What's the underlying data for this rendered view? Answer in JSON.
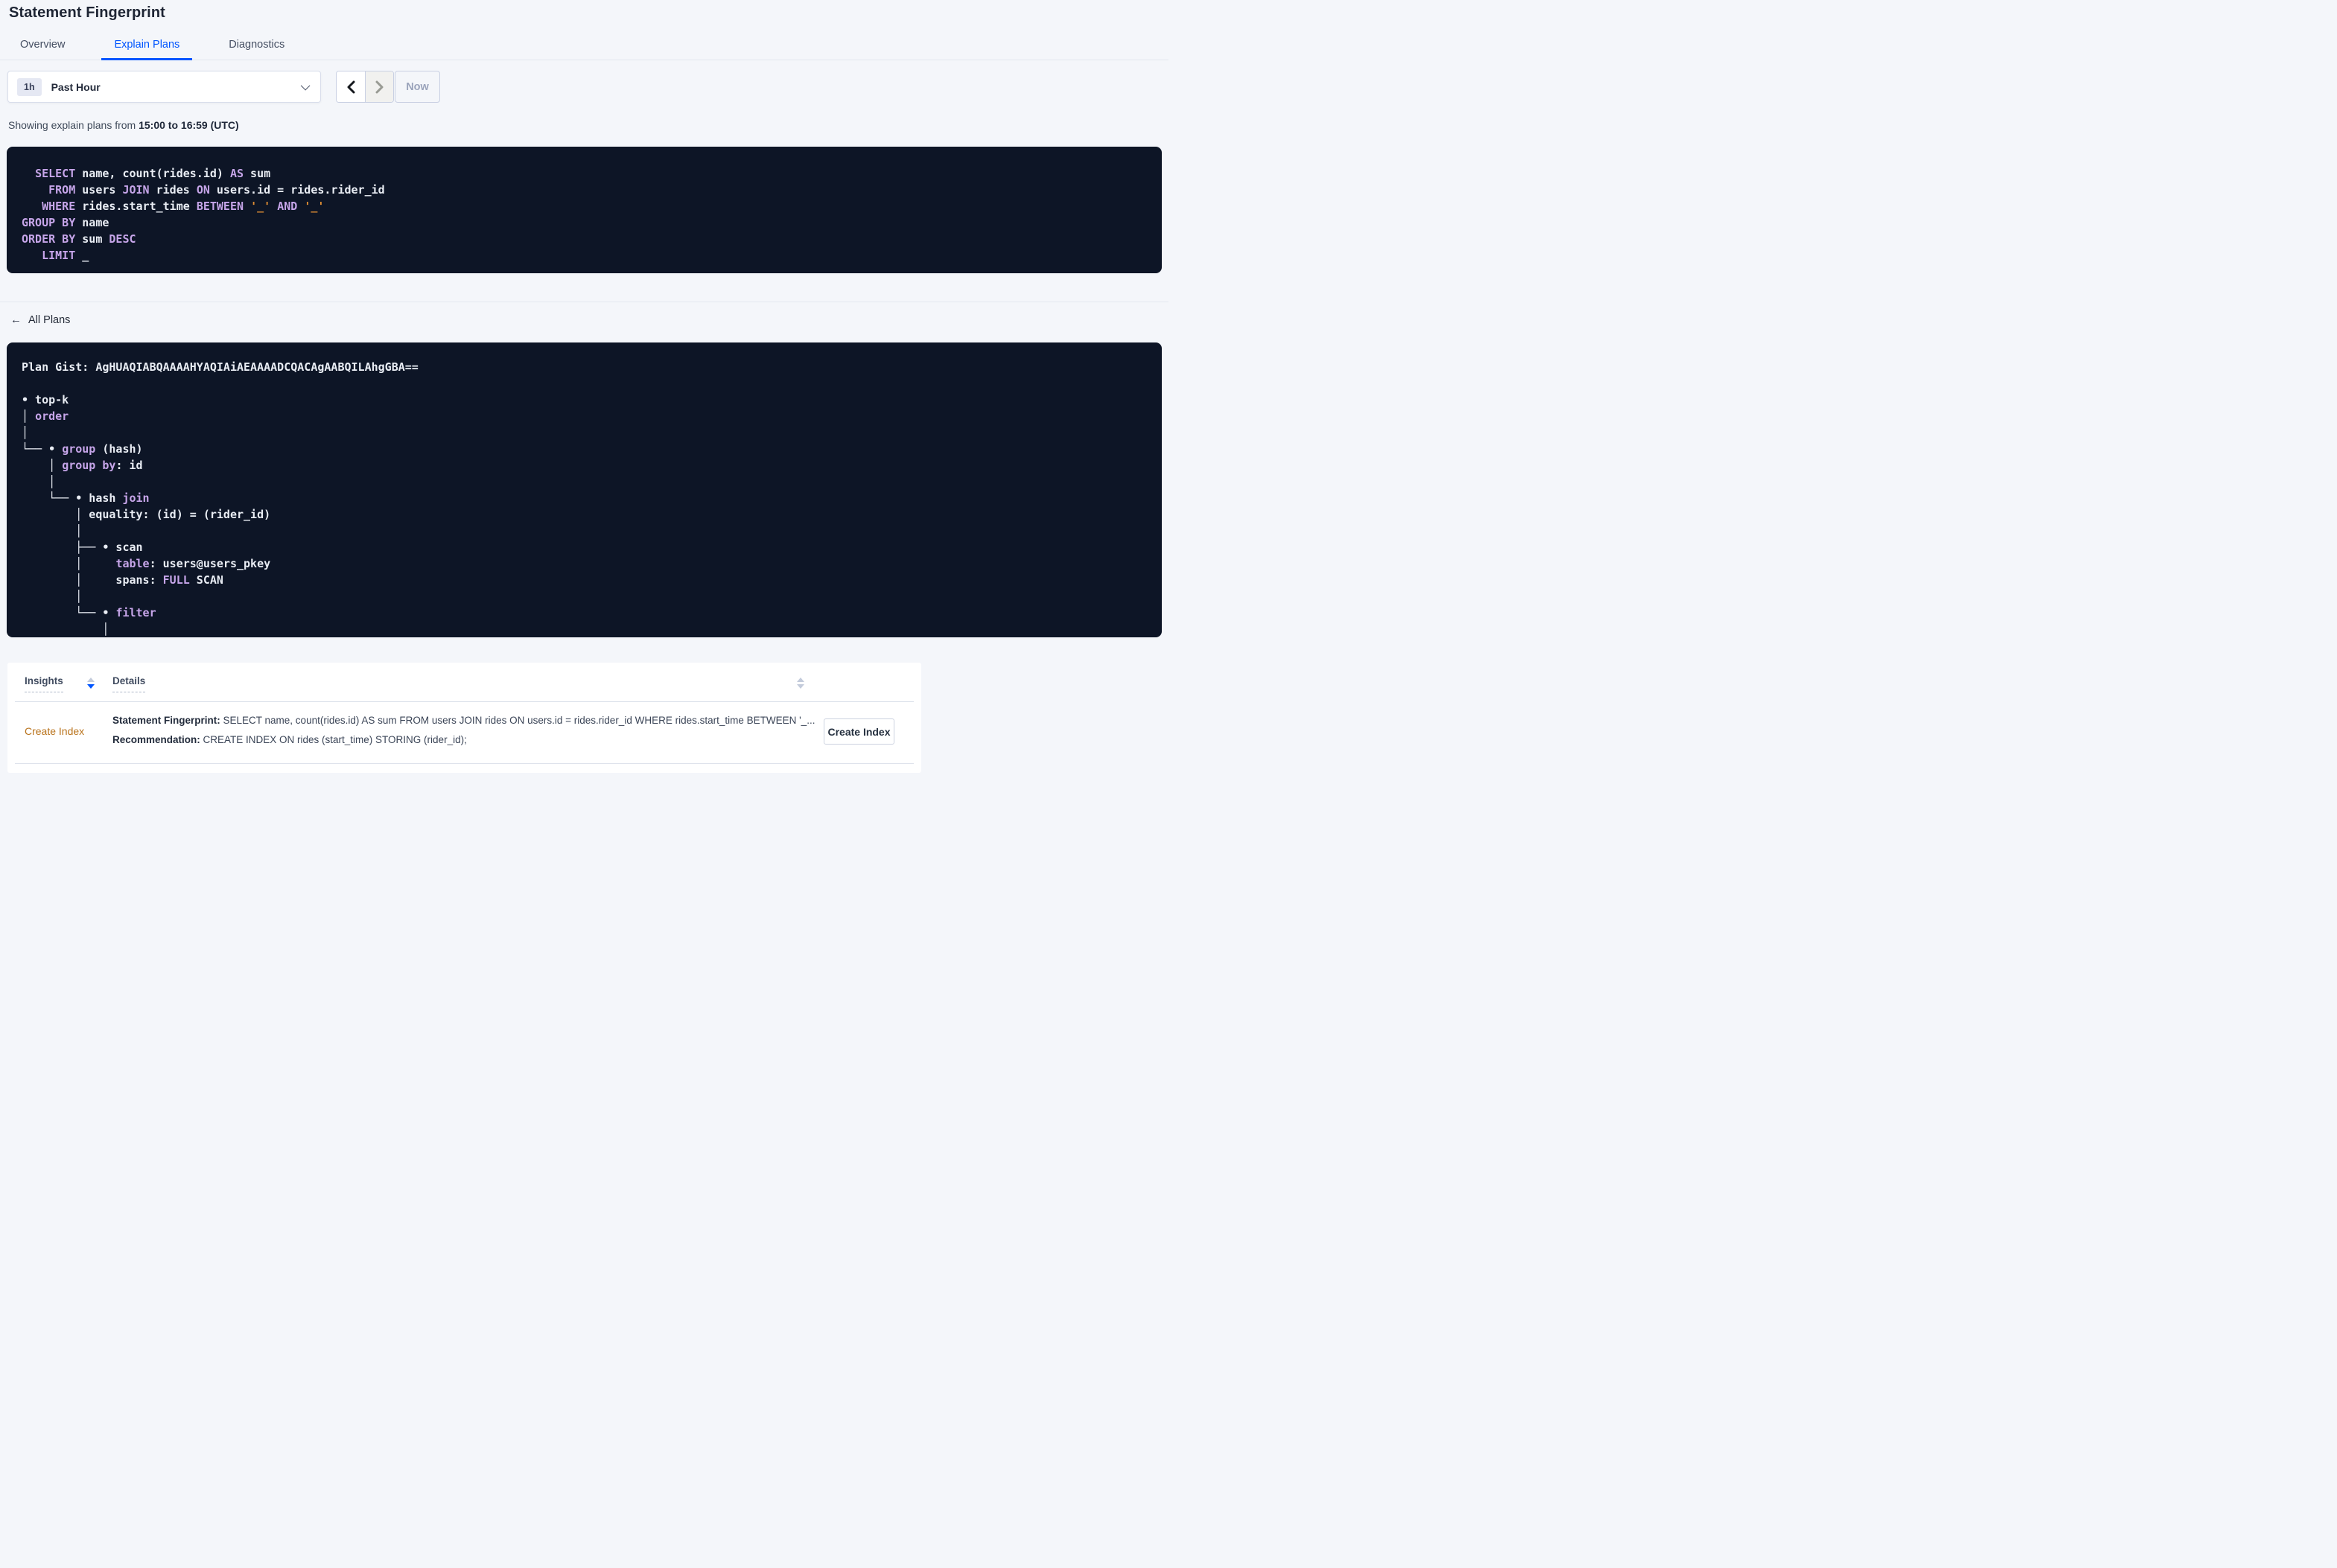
{
  "colors": {
    "accent_blue": "#0055ff",
    "code_background": "#0d1526",
    "code_keyword": "#c6a5e9",
    "code_literal": "#dd8c33",
    "code_text": "#e9edf4",
    "insight_orange": "#b9731c",
    "page_background": "#f4f6fa"
  },
  "icons": {
    "back_arrow": "←"
  },
  "page": {
    "title": "Statement Fingerprint"
  },
  "tabs": [
    {
      "label": "Overview",
      "active": false
    },
    {
      "label": "Explain Plans",
      "active": true
    },
    {
      "label": "Diagnostics",
      "active": false
    }
  ],
  "time_picker": {
    "interval_badge": "1h",
    "selected_range": "Past Hour",
    "now_label": "Now"
  },
  "summary": {
    "prefix": "Showing explain plans from ",
    "range": "15:00 to 16:59 (UTC)"
  },
  "sql_statement": {
    "lines": [
      [
        {
          "t": "  ",
          "c": "plain"
        },
        {
          "t": "SELECT",
          "c": "kw"
        },
        {
          "t": " name, count(rides.id) ",
          "c": "plain"
        },
        {
          "t": "AS",
          "c": "kw"
        },
        {
          "t": " sum",
          "c": "plain"
        }
      ],
      [
        {
          "t": "    ",
          "c": "plain"
        },
        {
          "t": "FROM",
          "c": "kw"
        },
        {
          "t": " users ",
          "c": "plain"
        },
        {
          "t": "JOIN",
          "c": "kw"
        },
        {
          "t": " rides ",
          "c": "plain"
        },
        {
          "t": "ON",
          "c": "kw"
        },
        {
          "t": " users.id = rides.rider_id",
          "c": "plain"
        }
      ],
      [
        {
          "t": "   ",
          "c": "plain"
        },
        {
          "t": "WHERE",
          "c": "kw"
        },
        {
          "t": " rides.start_time ",
          "c": "plain"
        },
        {
          "t": "BETWEEN",
          "c": "kw"
        },
        {
          "t": " ",
          "c": "plain"
        },
        {
          "t": "'_'",
          "c": "str"
        },
        {
          "t": " ",
          "c": "plain"
        },
        {
          "t": "AND",
          "c": "kw"
        },
        {
          "t": " ",
          "c": "plain"
        },
        {
          "t": "'_'",
          "c": "str"
        }
      ],
      [
        {
          "t": "GROUP BY",
          "c": "kw"
        },
        {
          "t": " name",
          "c": "plain"
        }
      ],
      [
        {
          "t": "ORDER BY",
          "c": "kw"
        },
        {
          "t": " sum ",
          "c": "plain"
        },
        {
          "t": "DESC",
          "c": "kw"
        }
      ],
      [
        {
          "t": "   ",
          "c": "plain"
        },
        {
          "t": "LIMIT",
          "c": "kw"
        },
        {
          "t": " _",
          "c": "plain"
        }
      ]
    ]
  },
  "plans_section": {
    "back_label": "All Plans"
  },
  "plan_panel": {
    "gist": "AgHUAQIABQAAAAHYAQIAiAEAAAADCQACAgAABQILAhgGBA==",
    "lines": [
      [
        {
          "t": "Plan Gist: AgHUAQIABQAAAAHYAQIAiAEAAAADCQACAgAABQILAhgGBA==",
          "c": "plain"
        }
      ],
      [],
      [
        {
          "t": "• top-k",
          "c": "plain"
        }
      ],
      [
        {
          "t": "│ ",
          "c": "plain"
        },
        {
          "t": "order",
          "c": "kw"
        }
      ],
      [
        {
          "t": "│",
          "c": "plain"
        }
      ],
      [
        {
          "t": "└── • ",
          "c": "plain"
        },
        {
          "t": "group",
          "c": "kw"
        },
        {
          "t": " (hash)",
          "c": "plain"
        }
      ],
      [
        {
          "t": "    │ ",
          "c": "plain"
        },
        {
          "t": "group by",
          "c": "kw"
        },
        {
          "t": ": id",
          "c": "plain"
        }
      ],
      [
        {
          "t": "    │",
          "c": "plain"
        }
      ],
      [
        {
          "t": "    └── • hash ",
          "c": "plain"
        },
        {
          "t": "join",
          "c": "kw"
        }
      ],
      [
        {
          "t": "        │ equality: (id) = (rider_id)",
          "c": "plain"
        }
      ],
      [
        {
          "t": "        │",
          "c": "plain"
        }
      ],
      [
        {
          "t": "        ├── • scan",
          "c": "plain"
        }
      ],
      [
        {
          "t": "        │     ",
          "c": "plain"
        },
        {
          "t": "table",
          "c": "kw"
        },
        {
          "t": ": users@users_pkey",
          "c": "plain"
        }
      ],
      [
        {
          "t": "        │     spans: ",
          "c": "plain"
        },
        {
          "t": "FULL",
          "c": "kw"
        },
        {
          "t": " SCAN",
          "c": "plain"
        }
      ],
      [
        {
          "t": "        │",
          "c": "plain"
        }
      ],
      [
        {
          "t": "        └── • ",
          "c": "plain"
        },
        {
          "t": "filter",
          "c": "kw"
        }
      ],
      [
        {
          "t": "            │",
          "c": "plain"
        }
      ]
    ]
  },
  "insights_table": {
    "columns": [
      {
        "label": "Insights"
      },
      {
        "label": "Details"
      }
    ],
    "rows": [
      {
        "insight": "Create Index",
        "fingerprint_label": "Statement Fingerprint:",
        "fingerprint_text": " SELECT name, count(rides.id) AS sum FROM users JOIN rides ON users.id = rides.rider_id WHERE rides.start_time BETWEEN '_...",
        "recommendation_label": "Recommendation:",
        "recommendation_text": " CREATE INDEX ON rides (start_time) STORING (rider_id);",
        "action_label": "Create Index"
      }
    ]
  }
}
